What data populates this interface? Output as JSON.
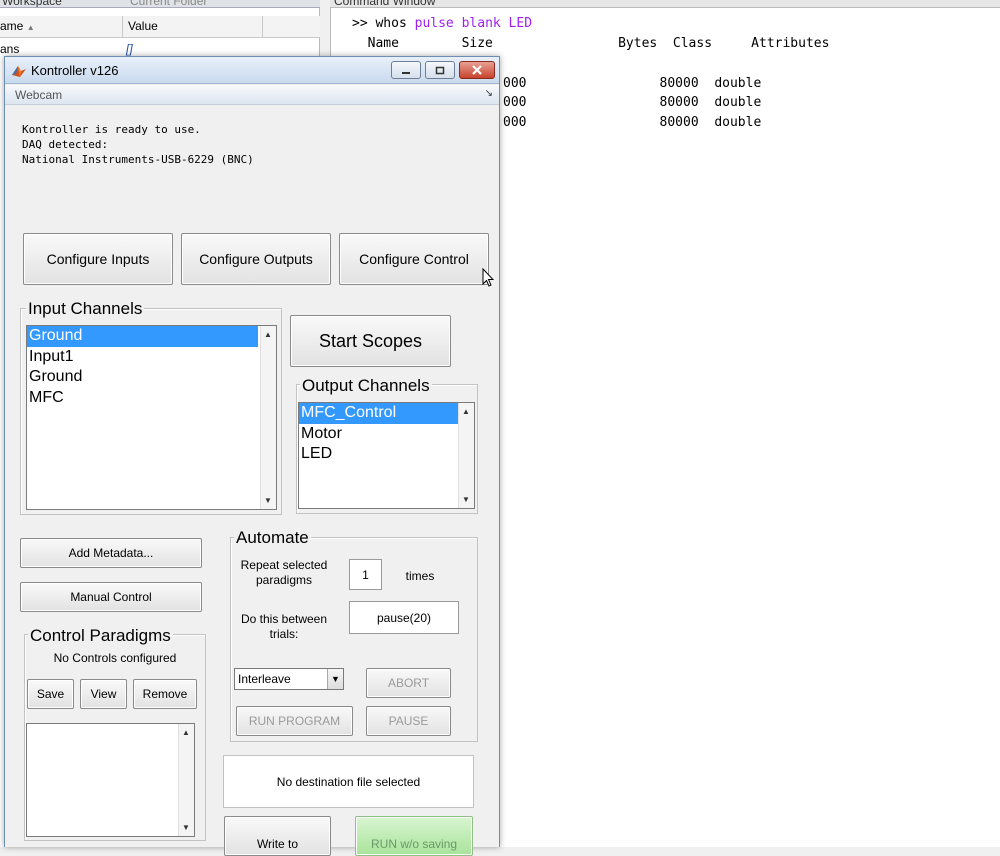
{
  "workspace": {
    "tab_workspace": "Workspace",
    "tab_current_folder": "Current Folder",
    "col_name": "ame",
    "col_value": "Value",
    "row_name": "ans",
    "row_value": "[]"
  },
  "command_window": {
    "title": "Command Window",
    "prompt": ">> whos",
    "args": "pulse blank LED",
    "header": "  Name        Size                Bytes  Class     Attributes",
    "rows": [
      "000                 80000  double",
      "000                 80000  double",
      "000                 80000  double"
    ]
  },
  "kontroller": {
    "title": "Kontroller v126",
    "menu_webcam": "Webcam",
    "status_lines": "Kontroller is ready to use.\nDAQ detected:\nNational Instruments-USB-6229 (BNC)",
    "buttons": {
      "configure_inputs": "Configure Inputs",
      "configure_outputs": "Configure Outputs",
      "configure_control": "Configure Control",
      "start_scopes": "Start Scopes",
      "add_metadata": "Add Metadata...",
      "manual_control": "Manual Control",
      "save": "Save",
      "view": "View",
      "remove": "Remove",
      "abort": "ABORT",
      "run_program": "RUN PROGRAM",
      "pause": "PAUSE",
      "write_to": "Write to",
      "run_wo_saving": "RUN w/o saving"
    },
    "input_channels": {
      "title": "Input Channels",
      "items": [
        "Ground",
        "Input1",
        "Ground",
        "MFC"
      ],
      "selected_index": 0
    },
    "output_channels": {
      "title": "Output Channels",
      "items": [
        "MFC_Control",
        "Motor",
        "LED"
      ],
      "selected_index": 0
    },
    "control_paradigms": {
      "title": "Control Paradigms",
      "status": "No Controls configured"
    },
    "automate": {
      "title": "Automate",
      "repeat_label": "Repeat selected paradigms",
      "repeat_value": "1",
      "times_label": "times",
      "between_label": "Do this between trials:",
      "between_value": "pause(20)",
      "mode_value": "Interleave"
    },
    "destination": "No destination file selected"
  },
  "colors": {
    "selection": "#3399ff",
    "command_purple": "#a020f0",
    "run_green": "#a9e39b"
  }
}
